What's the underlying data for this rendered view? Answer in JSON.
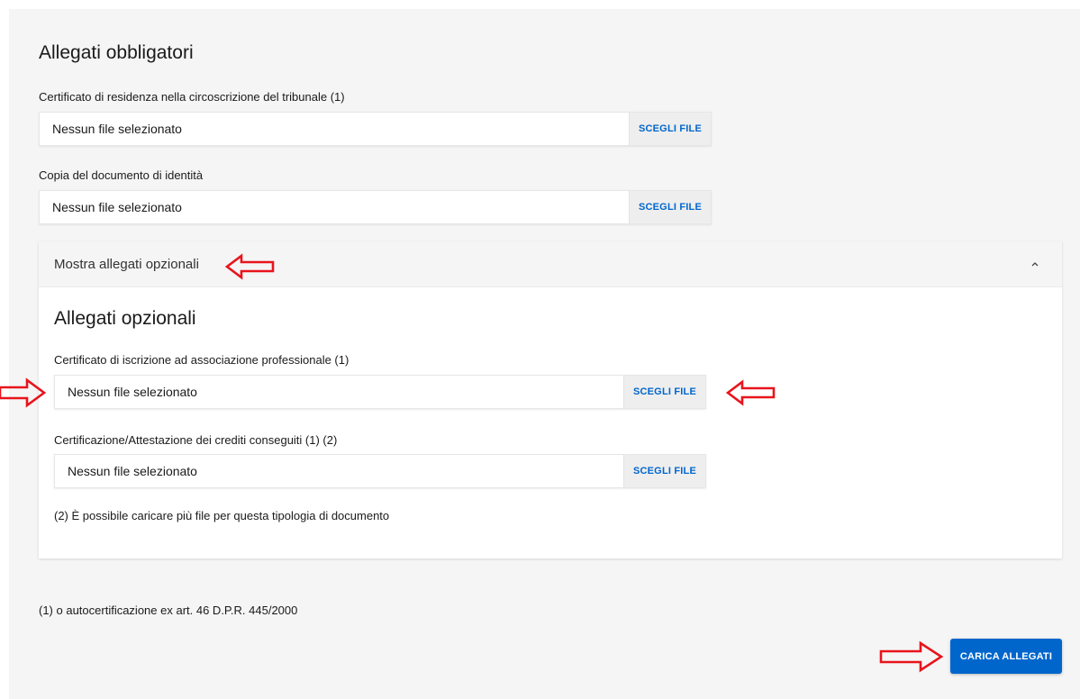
{
  "mandatory": {
    "title": "Allegati obbligatori",
    "fields": [
      {
        "label": "Certificato di residenza nella circoscrizione del tribunale (1)",
        "value": "Nessun file selezionato",
        "button": "SCEGLI FILE"
      },
      {
        "label": "Copia del documento di identità",
        "value": "Nessun file selezionato",
        "button": "SCEGLI FILE"
      }
    ]
  },
  "optional": {
    "toggle_label": "Mostra allegati opzionali",
    "toggle_icon": "chevron-up-icon",
    "title": "Allegati opzionali",
    "fields": [
      {
        "label": "Certificato di iscrizione ad associazione professionale (1)",
        "value": "Nessun file selezionato",
        "button": "SCEGLI FILE"
      },
      {
        "label": "Certificazione/Attestazione dei crediti conseguiti (1) (2)",
        "value": "Nessun file selezionato",
        "button": "SCEGLI FILE"
      }
    ],
    "note": "(2) È possibile caricare più file per questa tipologia di documento"
  },
  "footnote": "(1) o autocertificazione ex art. 46 D.P.R. 445/2000",
  "submit_label": "CARICA ALLEGATI",
  "colors": {
    "primary": "#0066cc",
    "annotation_arrow": "#e8141c",
    "panel_bg": "#f5f5f5"
  }
}
